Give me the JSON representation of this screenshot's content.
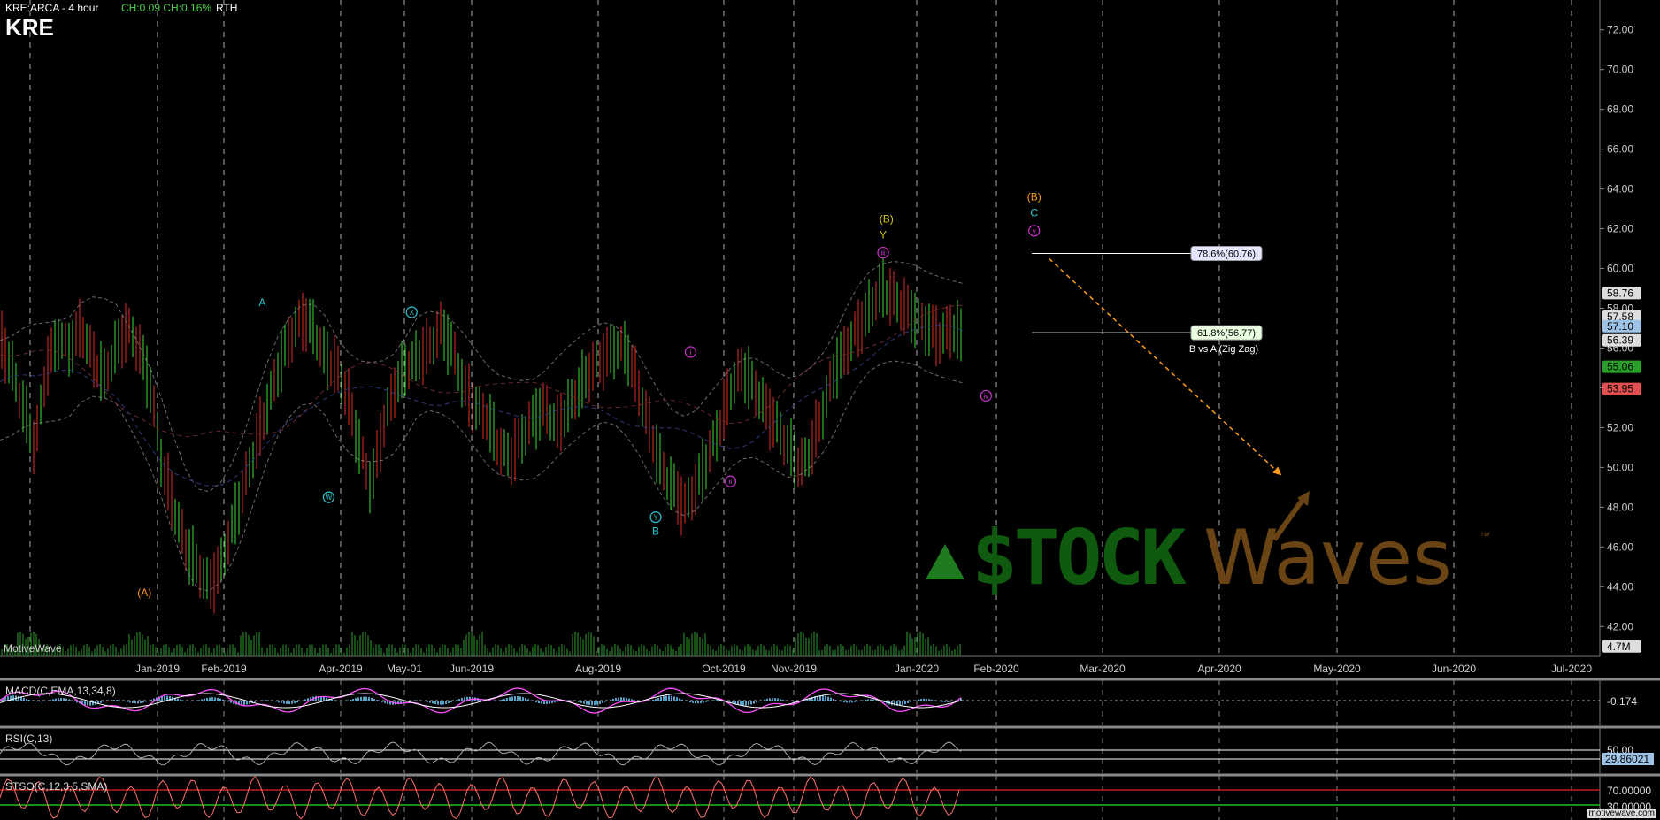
{
  "header": {
    "symbol_line": "KRE:ARCA - 4 hour",
    "change": "CH:0.09 CH:0.16%",
    "session": "RTH",
    "ticker": "KRE"
  },
  "watermark": {
    "brand_left": "$TOCK",
    "brand_right": "Waves",
    "tm": "™",
    "footer": "motivewave.com"
  },
  "platform_label": "MotiveWave",
  "colors": {
    "bg": "#000000",
    "up": "#3ddc3d",
    "down": "#e03030",
    "cyan": "#28c8d8",
    "magenta": "#d030d0",
    "orange": "#ff9a1a",
    "yellow": "#d8c820"
  },
  "chart_data": {
    "type": "line",
    "title": "KRE:ARCA - 4 hour",
    "price_axis": {
      "ticks": [
        "72.00",
        "70.00",
        "68.00",
        "66.00",
        "64.00",
        "62.00",
        "60.00",
        "58.00",
        "56.00",
        "54.00",
        "52.00",
        "50.00",
        "48.00",
        "46.00",
        "44.00",
        "42.00"
      ],
      "ylim": [
        40.5,
        73.5
      ]
    },
    "time_axis": {
      "ticks": [
        "Jan-2019",
        "Feb-2019",
        "Apr-2019",
        "May-01",
        "Jun-2019",
        "Aug-2019",
        "Oct-2019",
        "Nov-2019",
        "Jan-2020",
        "Feb-2020",
        "Mar-2020",
        "Apr-2020",
        "May-2020",
        "Jun-2020",
        "Jul-2020"
      ]
    },
    "price_tags": [
      {
        "text": "58.76",
        "value": 58.76,
        "color": "#dddddd",
        "fg": "#000000"
      },
      {
        "text": "57.58",
        "value": 57.58,
        "color": "#dddddd",
        "fg": "#000000"
      },
      {
        "text": "57.10",
        "value": 57.1,
        "color": "#9ec3e6",
        "fg": "#000000"
      },
      {
        "text": "56.39",
        "value": 56.39,
        "color": "#dddddd",
        "fg": "#000000"
      },
      {
        "text": "55.06",
        "value": 55.06,
        "color": "#2aa02a",
        "fg": "#000000"
      },
      {
        "text": "53.95",
        "value": 53.95,
        "color": "#e05050",
        "fg": "#000000"
      },
      {
        "text": "4.7M",
        "value": 41.0,
        "color": "#dddddd",
        "fg": "#000000"
      }
    ],
    "price_series": [
      56.5,
      55,
      53,
      51,
      55,
      56.5,
      56,
      57,
      55.5,
      54.5,
      56,
      57,
      56,
      54,
      50,
      48,
      46,
      45,
      44,
      45,
      47,
      49,
      51,
      53,
      55,
      56.5,
      57.5,
      57,
      55.5,
      55,
      53.5,
      51,
      49,
      52,
      54,
      55,
      55.5,
      56,
      57,
      56,
      54,
      53,
      52.5,
      51,
      50.5,
      51.5,
      52.5,
      53,
      52,
      53,
      54,
      55,
      55.5,
      56,
      56,
      54,
      52,
      50,
      49,
      48,
      49,
      50.5,
      52,
      54,
      55,
      54,
      53,
      52,
      51,
      50,
      51,
      53,
      55,
      56,
      57,
      58,
      59,
      58.5,
      58,
      57.5,
      57,
      56.5,
      57,
      56.5
    ],
    "wave_labels": [
      {
        "text": "A",
        "x_frac": 0.158,
        "price": 58.3,
        "color": "#28c8d8",
        "circle": false
      },
      {
        "text": "X",
        "x_frac": 0.248,
        "price": 57.8,
        "color": "#28c8d8",
        "circle": true
      },
      {
        "text": "W",
        "x_frac": 0.198,
        "price": 48.5,
        "color": "#28c8d8",
        "circle": true
      },
      {
        "text": "(A)",
        "x_frac": 0.087,
        "price": 43.7,
        "color": "#ff9a1a",
        "circle": false
      },
      {
        "text": "Y",
        "x_frac": 0.395,
        "price": 47.5,
        "color": "#28c8d8",
        "circle": true
      },
      {
        "text": "B",
        "x_frac": 0.395,
        "price": 46.8,
        "color": "#28c8d8",
        "circle": false
      },
      {
        "text": "i",
        "x_frac": 0.416,
        "price": 55.8,
        "color": "#d030d0",
        "circle": true
      },
      {
        "text": "ii",
        "x_frac": 0.44,
        "price": 49.3,
        "color": "#d030d0",
        "circle": true
      },
      {
        "text": "iii",
        "x_frac": 0.532,
        "price": 60.8,
        "color": "#d030d0",
        "circle": true
      },
      {
        "text": "iv",
        "x_frac": 0.594,
        "price": 53.6,
        "color": "#d030d0",
        "circle": true
      },
      {
        "text": "(B)",
        "x_frac": 0.534,
        "price": 62.5,
        "color": "#d8c820",
        "circle": false
      },
      {
        "text": "Y",
        "x_frac": 0.532,
        "price": 61.7,
        "color": "#d8c820",
        "circle": false
      },
      {
        "text": "(B)",
        "x_frac": 0.623,
        "price": 63.6,
        "color": "#ff9a1a",
        "circle": false
      },
      {
        "text": "C",
        "x_frac": 0.623,
        "price": 62.8,
        "color": "#28c8d8",
        "circle": false
      },
      {
        "text": "v",
        "x_frac": 0.623,
        "price": 61.9,
        "color": "#d030d0",
        "circle": true
      }
    ],
    "fib_levels": [
      {
        "label": "78.6%(60.76)",
        "value": 60.76
      },
      {
        "label": "61.8%(56.77)",
        "value": 56.77
      }
    ],
    "fib_note": "B vs A (Zig Zag)",
    "projection": {
      "from": {
        "x_frac": 0.632,
        "price": 60.5
      },
      "to": {
        "x_frac": 0.772,
        "price": 49.6
      }
    }
  },
  "indicators": {
    "macd": {
      "label": "MACD(C,EMA,13,34,8)",
      "value": "-0.174"
    },
    "rsi": {
      "label": "RSI(C,13)",
      "level": "50.00",
      "value": "29.86021"
    },
    "stoch": {
      "label": "STSO(C,12,3,5,SMA)",
      "upper": "70.00000",
      "lower": "30.00000"
    }
  }
}
